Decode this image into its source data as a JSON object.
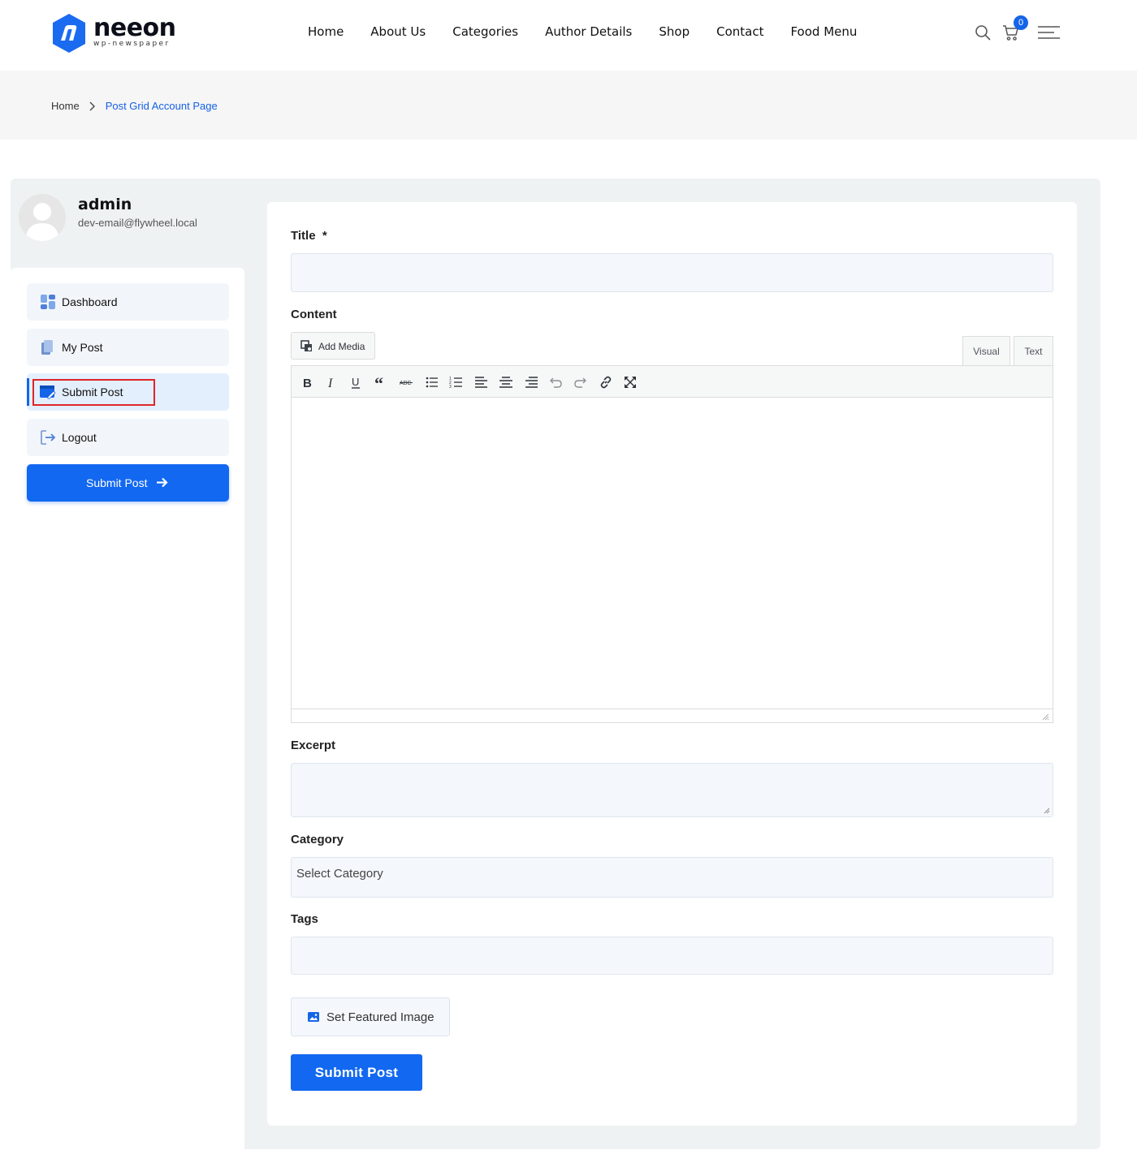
{
  "brand": {
    "name": "neeon",
    "tagline": "wp-newspaper",
    "accent": "#1268f0"
  },
  "nav": {
    "items": [
      "Home",
      "About Us",
      "Categories",
      "Author Details",
      "Shop",
      "Contact",
      "Food Menu"
    ]
  },
  "header": {
    "cart_count": "0"
  },
  "breadcrumb": {
    "home": "Home",
    "current": "Post Grid Account Page"
  },
  "user": {
    "name": "admin",
    "email": "dev-email@flywheel.local"
  },
  "sidebar": {
    "items": [
      {
        "label": "Dashboard",
        "icon": "dashboard-icon"
      },
      {
        "label": "My Post",
        "icon": "pages-icon"
      },
      {
        "label": "Submit Post",
        "icon": "edit-card-icon",
        "active": true
      },
      {
        "label": "Logout",
        "icon": "logout-icon"
      }
    ],
    "cta_label": "Submit Post"
  },
  "form": {
    "title_label": "Title",
    "required_mark": "*",
    "content_label": "Content",
    "add_media": "Add Media",
    "tab_visual": "Visual",
    "tab_text": "Text",
    "excerpt_label": "Excerpt",
    "category_label": "Category",
    "category_value": "Select Category",
    "tags_label": "Tags",
    "featured_image": "Set Featured Image",
    "submit_label": "Submit Post"
  }
}
